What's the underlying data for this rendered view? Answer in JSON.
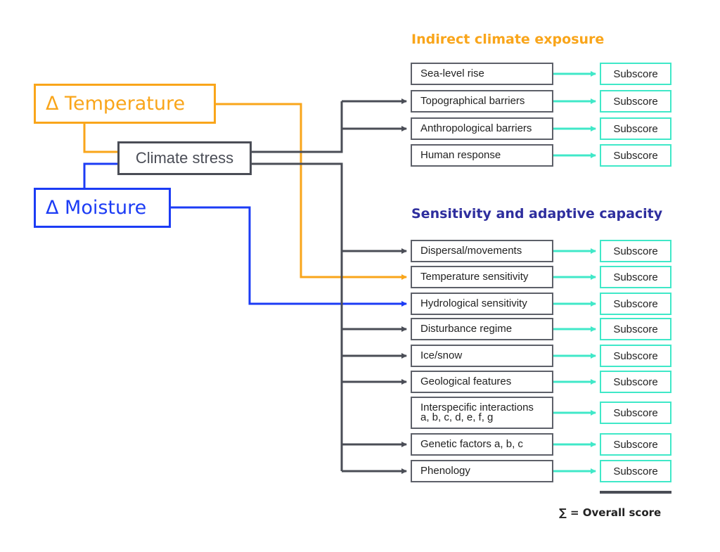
{
  "colors": {
    "temperature": "#f9a51a",
    "moisture": "#1c3cf5",
    "stress": "#4a4d56",
    "subscore": "#40e8c8",
    "indirect_heading": "#f9a51a",
    "sensitivity_heading": "#2e2e9e"
  },
  "drivers": {
    "temperature": "Δ Temperature",
    "moisture": "Δ Moisture",
    "climate_stress": "Climate stress"
  },
  "indirect": {
    "heading": "Indirect climate exposure",
    "factors": [
      {
        "label": "Sea-level rise",
        "input": "none",
        "subscore": "Subscore"
      },
      {
        "label": "Topographical barriers",
        "input": "climate-stress",
        "subscore": "Subscore"
      },
      {
        "label": "Anthropological barriers",
        "input": "climate-stress",
        "subscore": "Subscore"
      },
      {
        "label": "Human response",
        "input": "none",
        "subscore": "Subscore"
      }
    ]
  },
  "sensitivity": {
    "heading": "Sensitivity and adaptive capacity",
    "factors": [
      {
        "label": "Dispersal/movements",
        "input": "climate-stress",
        "subscore": "Subscore"
      },
      {
        "label": "Temperature sensitivity",
        "input": "temperature",
        "subscore": "Subscore"
      },
      {
        "label": "Hydrological sensitivity",
        "input": "moisture",
        "subscore": "Subscore"
      },
      {
        "label": "Disturbance regime",
        "input": "climate-stress",
        "subscore": "Subscore"
      },
      {
        "label": "Ice/snow",
        "input": "climate-stress",
        "subscore": "Subscore"
      },
      {
        "label": "Geological features",
        "input": "climate-stress",
        "subscore": "Subscore"
      },
      {
        "label": "Interspecific interactions",
        "label2": "a, b, c, d, e, f, g",
        "input": "none",
        "subscore": "Subscore"
      },
      {
        "label": "Genetic factors a, b, c",
        "input": "climate-stress",
        "subscore": "Subscore"
      },
      {
        "label": "Phenology",
        "input": "climate-stress",
        "subscore": "Subscore"
      }
    ]
  },
  "summary": "∑ = Overall score"
}
